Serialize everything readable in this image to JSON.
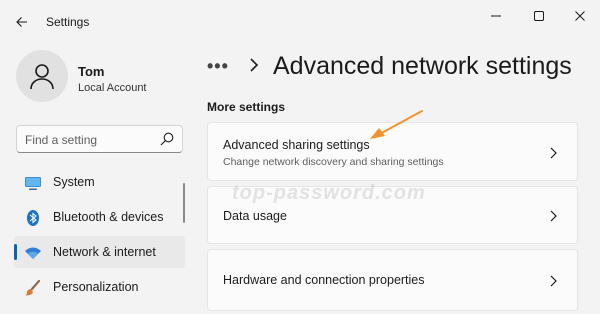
{
  "titlebar": {
    "title": "Settings"
  },
  "user": {
    "name": "Tom",
    "account_type": "Local Account"
  },
  "search": {
    "placeholder": "Find a setting"
  },
  "nav": {
    "items": [
      {
        "label": "System",
        "icon": "system-monitor-icon",
        "active": false
      },
      {
        "label": "Bluetooth & devices",
        "icon": "bluetooth-icon",
        "active": false
      },
      {
        "label": "Network & internet",
        "icon": "wifi-icon",
        "active": true
      },
      {
        "label": "Personalization",
        "icon": "brush-icon",
        "active": false
      }
    ]
  },
  "breadcrumb": {
    "more": "•••",
    "title": "Advanced network settings"
  },
  "section": {
    "title": "More settings"
  },
  "cards": [
    {
      "title": "Advanced sharing settings",
      "subtitle": "Change network discovery and sharing settings"
    },
    {
      "title": "Data usage"
    },
    {
      "title": "Hardware and connection properties"
    }
  ],
  "watermark": "top-password.com",
  "colors": {
    "accent": "#0067c0",
    "arrow": "#f5932b",
    "background": "#f3f3f3",
    "card": "#fbfbfb"
  }
}
